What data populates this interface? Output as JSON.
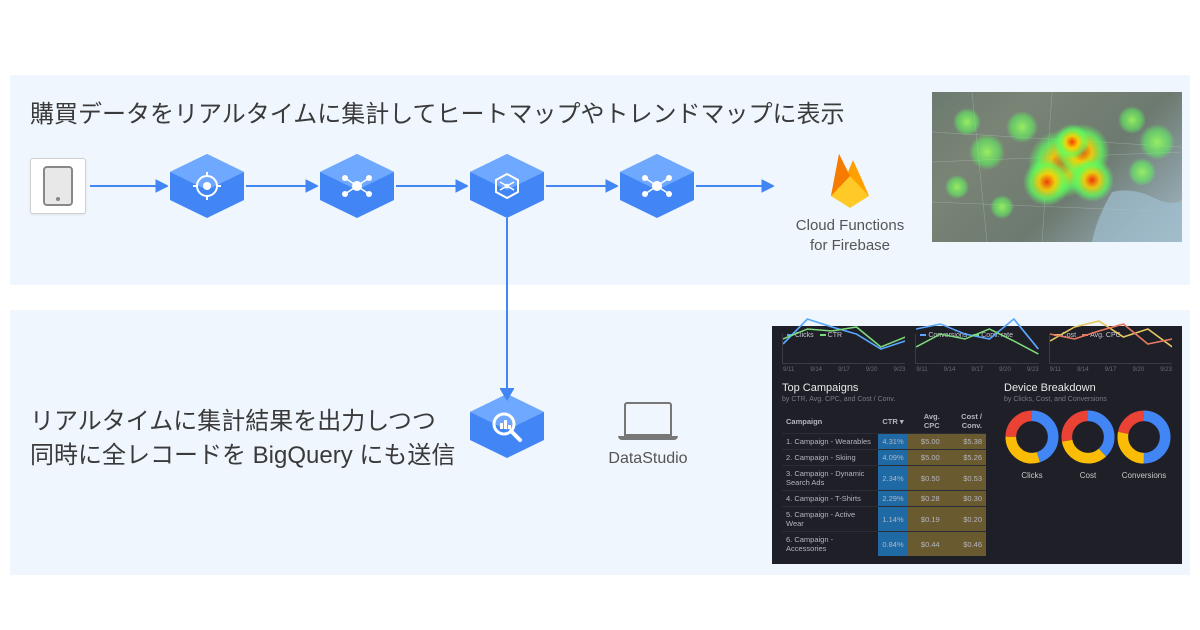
{
  "top_panel": {
    "headline": "購買データをリアルタイムに集計してヒートマップやトレンドマップに表示",
    "firebase_label_line1": "Cloud Functions",
    "firebase_label_line2": "for Firebase"
  },
  "bottom_panel": {
    "headline_line1": "リアルタイムに集計結果を出力しつつ",
    "headline_line2": "同時に全レコードを BigQuery にも送信",
    "datastudio_label": "DataStudio"
  },
  "icons": {
    "device": "tablet-icon",
    "hex1": "gcp-endpoint-hex-icon",
    "hex2": "gcp-pubsub-hex-icon",
    "hex3": "gcp-dataflow-hex-icon",
    "hex4": "gcp-pubsub-hex-icon",
    "hex_bq": "gcp-bigquery-hex-icon",
    "firebase": "firebase-flame-icon",
    "laptop": "laptop-icon"
  },
  "dashboard": {
    "charts": [
      {
        "legends": [
          "Clicks",
          "CTR"
        ],
        "ticks": [
          "9/11",
          "9/14",
          "9/17",
          "9/20",
          "9/23"
        ]
      },
      {
        "legends": [
          "Conversions",
          "Conv. rate"
        ],
        "ticks": [
          "9/11",
          "9/14",
          "9/17",
          "9/20",
          "9/23"
        ]
      },
      {
        "legends": [
          "Cost",
          "Avg. CPC"
        ],
        "ticks": [
          "9/11",
          "9/14",
          "9/17",
          "9/20",
          "9/23"
        ]
      }
    ],
    "table": {
      "title": "Top Campaigns",
      "subtitle": "by CTR, Avg. CPC, and Cost / Conv.",
      "columns": [
        "Campaign",
        "CTR ▾",
        "Avg. CPC",
        "Cost / Conv."
      ],
      "rows": [
        {
          "idx": "1.",
          "name": "Campaign - Wearables",
          "ctr": "4.31%",
          "cpc": "$5.00",
          "cost": "$5.38"
        },
        {
          "idx": "2.",
          "name": "Campaign - Skiing",
          "ctr": "4.09%",
          "cpc": "$5.00",
          "cost": "$5.26"
        },
        {
          "idx": "3.",
          "name": "Campaign - Dynamic Search Ads",
          "ctr": "2.34%",
          "cpc": "$0.50",
          "cost": "$0.53"
        },
        {
          "idx": "4.",
          "name": "Campaign - T-Shirts",
          "ctr": "2.29%",
          "cpc": "$0.28",
          "cost": "$0.30"
        },
        {
          "idx": "5.",
          "name": "Campaign - Active Wear",
          "ctr": "1.14%",
          "cpc": "$0.19",
          "cost": "$0.20"
        },
        {
          "idx": "6.",
          "name": "Campaign - Accessories",
          "ctr": "0.84%",
          "cpc": "$0.44",
          "cost": "$0.46"
        }
      ]
    },
    "breakdown": {
      "title": "Device Breakdown",
      "subtitle": "by Clicks, Cost, and Conversions",
      "donuts": [
        "Clicks",
        "Cost",
        "Conversions"
      ]
    }
  }
}
